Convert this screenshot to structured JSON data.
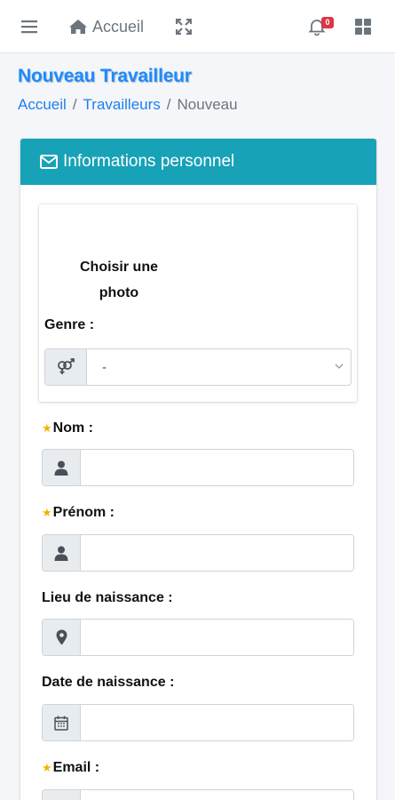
{
  "navbar": {
    "menu_icon": "bars-icon",
    "home_icon": "home-icon",
    "home_label": "Accueil",
    "expand_icon": "expand-icon",
    "notification_icon": "bell-icon",
    "notification_count": "0",
    "apps_icon": "grid-icon"
  },
  "header": {
    "title": "Nouveau Travailleur",
    "breadcrumb": [
      "Accueil",
      "Travailleurs",
      "Nouveau"
    ]
  },
  "card": {
    "title": "Informations personnel",
    "title_icon": "envelope-icon",
    "header_color": "#17a2b8",
    "photo": {
      "label": "Choisir une photo"
    },
    "genre": {
      "label": "Genre :",
      "icon": "venus-mars-icon",
      "selected": "-"
    },
    "fields": [
      {
        "label": "Nom :",
        "required": true,
        "icon": "user-icon",
        "value": ""
      },
      {
        "label": "Prénom :",
        "required": true,
        "icon": "user-icon",
        "value": ""
      },
      {
        "label": "Lieu de naissance :",
        "required": false,
        "icon": "map-marker-icon",
        "value": ""
      },
      {
        "label": "Date de naissance :",
        "required": false,
        "icon": "calendar-icon",
        "value": ""
      },
      {
        "label": "Email :",
        "required": true,
        "icon": "at-icon",
        "value": ""
      }
    ],
    "required_mark": "★"
  },
  "colors": {
    "title": "#1a8cff",
    "link": "#1f7ef0",
    "badge": "#dc3545",
    "required_star": "#f5b301"
  }
}
